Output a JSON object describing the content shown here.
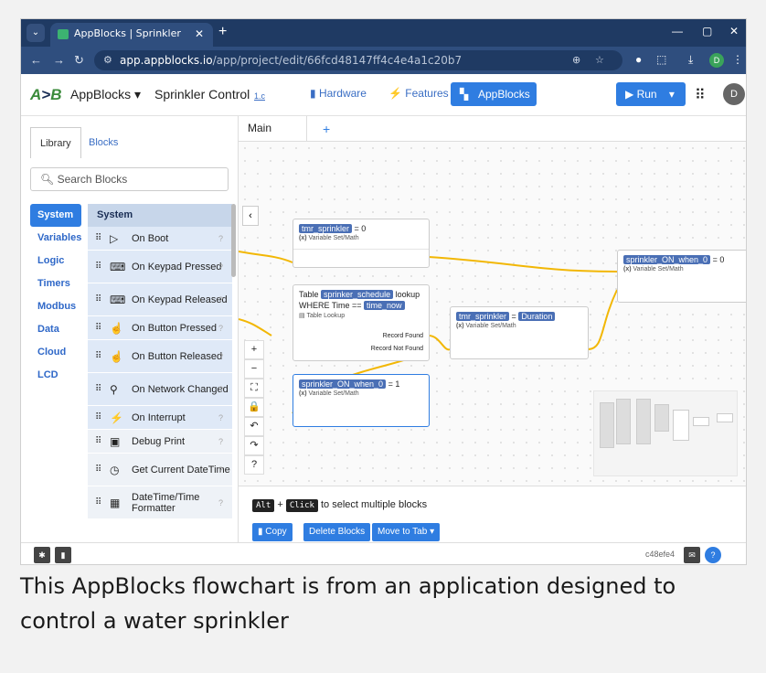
{
  "browser": {
    "tab_title": "AppBlocks | Sprinkler Control",
    "url_host": "app.appblocks.io",
    "url_path": "/app/project/edit/66fcd48147ff4c4e4a1c20b7",
    "profile_initial": "D"
  },
  "app": {
    "name": "AppBlocks",
    "project": "Sprinkler Control",
    "version": "1.c",
    "nav": [
      "Hardware",
      "Features",
      "AppBlocks"
    ],
    "run_label": "Run",
    "avatar": "D"
  },
  "library": {
    "tabs": [
      "Library",
      "Blocks"
    ],
    "search_placeholder": "Search Blocks",
    "categories": [
      "System",
      "Variables",
      "Logic",
      "Timers",
      "Modbus",
      "Data",
      "Cloud",
      "LCD"
    ],
    "list_header": "System",
    "items": [
      {
        "label": "On Boot",
        "icon": "play-icon"
      },
      {
        "label": "On Keypad Pressed",
        "icon": "keyboard-icon"
      },
      {
        "label": "On Keypad Released",
        "icon": "keyboard-icon"
      },
      {
        "label": "On Button Pressed",
        "icon": "hand-pointer-icon"
      },
      {
        "label": "On Button Released",
        "icon": "hand-pointer-icon"
      },
      {
        "label": "On Network Changed",
        "icon": "network-icon"
      },
      {
        "label": "On Interrupt",
        "icon": "bolt-icon"
      },
      {
        "label": "Debug Print",
        "icon": "debug-icon"
      },
      {
        "label": "Get Current DateTime",
        "icon": "clock-icon"
      },
      {
        "label": "DateTime/Time Formatter",
        "icon": "calendar-icon"
      }
    ]
  },
  "canvas": {
    "tab": "Main",
    "nodes": {
      "n1": {
        "var": "tmr_sprinkler",
        "expr": "= 0",
        "type": "Variable Set/Math"
      },
      "n2": {
        "pre": "Table",
        "table": "sprinker_schedule",
        "post": "lookup",
        "where": "WHERE Time ==",
        "field": "time_now",
        "type": "Table Lookup",
        "out1": "Record Found",
        "out2": "Record Not Found"
      },
      "n3": {
        "var": "sprinkler_ON_when_0",
        "expr": "= 1",
        "type": "Variable Set/Math"
      },
      "n4": {
        "var": "tmr_sprinkler",
        "eq": "=",
        "val": "Duration",
        "type": "Variable Set/Math"
      },
      "n5": {
        "var": "sprinkler_ON_when_0",
        "expr": "= 0",
        "type": "Variable Set/Math"
      }
    },
    "zoom_controls": [
      "+",
      "−",
      "⛶",
      "🔒",
      "↶",
      "↷",
      "?"
    ],
    "hint": {
      "key1": "Alt",
      "plus": "+",
      "key2": "Click",
      "text": "to select multiple blocks"
    },
    "actions": [
      "Copy",
      "Delete Blocks",
      "Move to Tab"
    ]
  },
  "footer": {
    "hash": "c48efe4"
  },
  "caption": "This AppBlocks flowchart is from an application designed to control a water sprinkler",
  "colors": {
    "accent": "#2f7de1",
    "wire": "#f2b705",
    "chip": "#4a6fb5"
  }
}
